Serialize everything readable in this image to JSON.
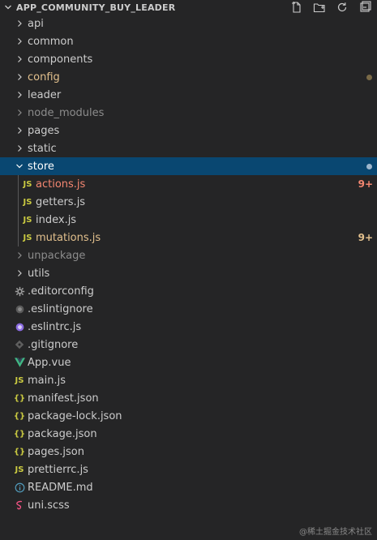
{
  "explorer": {
    "title": "APP_COMMUNITY_BUY_LEADER",
    "actions": [
      "new-file",
      "new-folder",
      "refresh",
      "collapse-all"
    ]
  },
  "colors": {
    "background": "#252526",
    "selected": "#094771",
    "text": "#cccccc",
    "dim": "#8c8c8c",
    "modified": "#e2c08d",
    "error": "#f48771",
    "js_icon": "#cbcb41",
    "json_icon": "#cbcb41",
    "vue_icon": "#41b883"
  },
  "tree": {
    "folders": {
      "api": "api",
      "common": "common",
      "components": "components",
      "config": "config",
      "leader": "leader",
      "node_modules": "node_modules",
      "pages": "pages",
      "static": "static",
      "store": "store",
      "unpackage": "unpackage",
      "utils": "utils"
    },
    "store_children": {
      "actions": {
        "name": "actions.js",
        "badge": "9+"
      },
      "getters": {
        "name": "getters.js"
      },
      "index": {
        "name": "index.js"
      },
      "mutations": {
        "name": "mutations.js",
        "badge": "9+"
      }
    },
    "files": {
      "editorconfig": ".editorconfig",
      "eslintignore": ".eslintignore",
      "eslintrc": ".eslintrc.js",
      "gitignore": ".gitignore",
      "app_vue": "App.vue",
      "main_js": "main.js",
      "manifest": "manifest.json",
      "package_lock": "package-lock.json",
      "package": "package.json",
      "pages_json": "pages.json",
      "prettierrc": "prettierrc.js",
      "readme": "README.md",
      "uni_scss": "uni.scss"
    },
    "icons": {
      "js_text": "JS",
      "json_text": "{}"
    }
  },
  "watermark": "@稀土掘金技术社区"
}
